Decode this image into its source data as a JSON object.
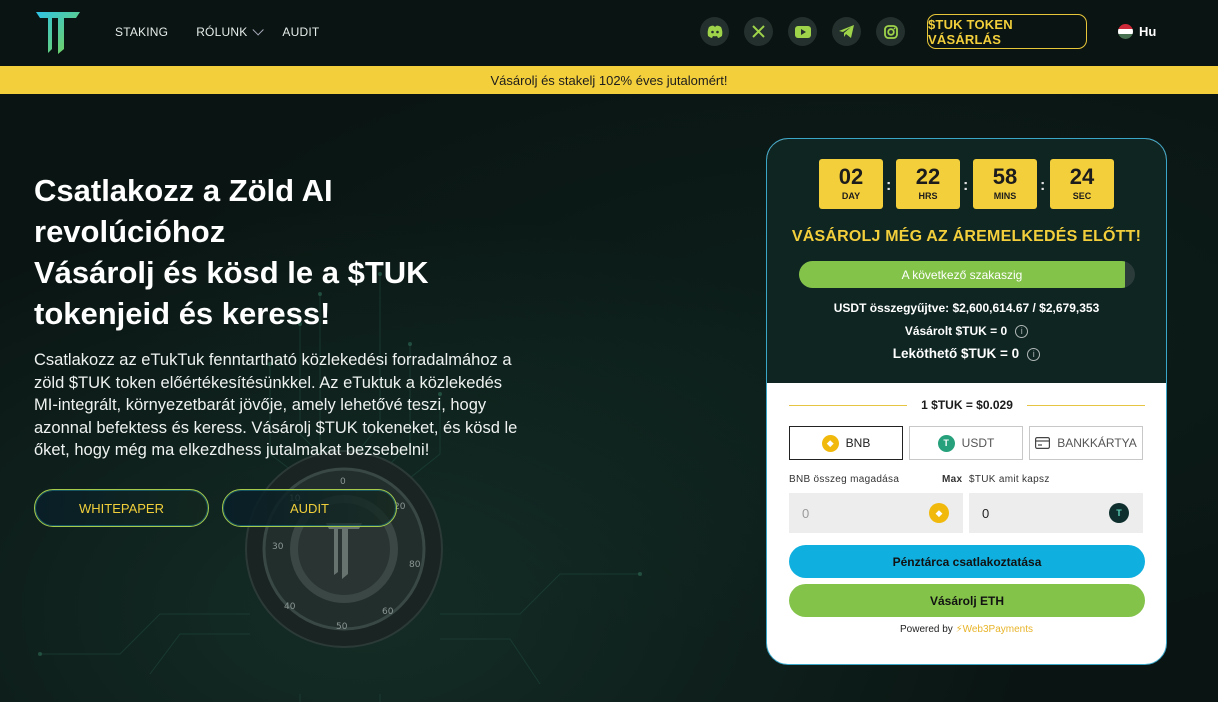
{
  "nav": {
    "links": [
      "STAKING",
      "RÓLUNK",
      "AUDIT"
    ],
    "socials": [
      "discord-icon",
      "x-icon",
      "youtube-icon",
      "telegram-icon",
      "instagram-icon"
    ],
    "buy_label": "$TUK TOKEN VÁSÁRLÁS",
    "lang_label": "Hu"
  },
  "banner": {
    "text": "Vásárolj és stakelj 102% éves jutalomért!"
  },
  "hero": {
    "title_lines": [
      "Csatlakozz a  Zöld AI",
      "revolúcióhoz",
      "Vásárolj és kösd le a $TUK",
      "tokenjeid és keress!"
    ],
    "description": "Csatlakozz az eTukTuk fenntartható közlekedési forradalmához a zöld $TUK token előértékesítésünkkel. Az eTuktuk a közlekedés MI-integrált, környezetbarát jövője, amely lehetővé teszi, hogy azonnal befektess és keress. Vásárolj $TUK tokeneket, és kösd le őket, hogy még ma elkezdhess jutalmakat bezsebelni!",
    "whitepaper_label": "WHITEPAPER",
    "audit_label": "AUDIT"
  },
  "presale": {
    "countdown": [
      {
        "value": "02",
        "unit": "DAY"
      },
      {
        "value": "22",
        "unit": "HRS"
      },
      {
        "value": "58",
        "unit": "MINS"
      },
      {
        "value": "24",
        "unit": "SEC"
      }
    ],
    "heading": "VÁSÁROLJ MÉG AZ ÁREMELKEDÉS ELŐTT!",
    "progress_label": "A következő szakaszig",
    "progress_fraction": 0.97,
    "usdt_raised": "USDT összegyűjtve: $2,600,614.67 / $2,679,353",
    "bought": "Vásárolt $TUK = 0",
    "stakeable": "Leköthető $TUK = 0",
    "rate": "1 $TUK = $0.029",
    "pay_methods": [
      "BNB",
      "USDT",
      "BANKKÁRTYA"
    ],
    "amount_label": "BNB összeg magadása",
    "max_label": "Max",
    "receive_label": "$TUK amit kapsz",
    "amount_value": "0",
    "receive_value": "0",
    "connect_label": "Pénztárca csatlakoztatása",
    "buy_eth_label": "Vásárolj ETH",
    "powered_by": "Powered by",
    "powered_brand": "Web3Payments"
  },
  "colors": {
    "accent_yellow": "#f4cf3c",
    "accent_green": "#83c34a",
    "accent_blue": "#0fb0e0"
  }
}
